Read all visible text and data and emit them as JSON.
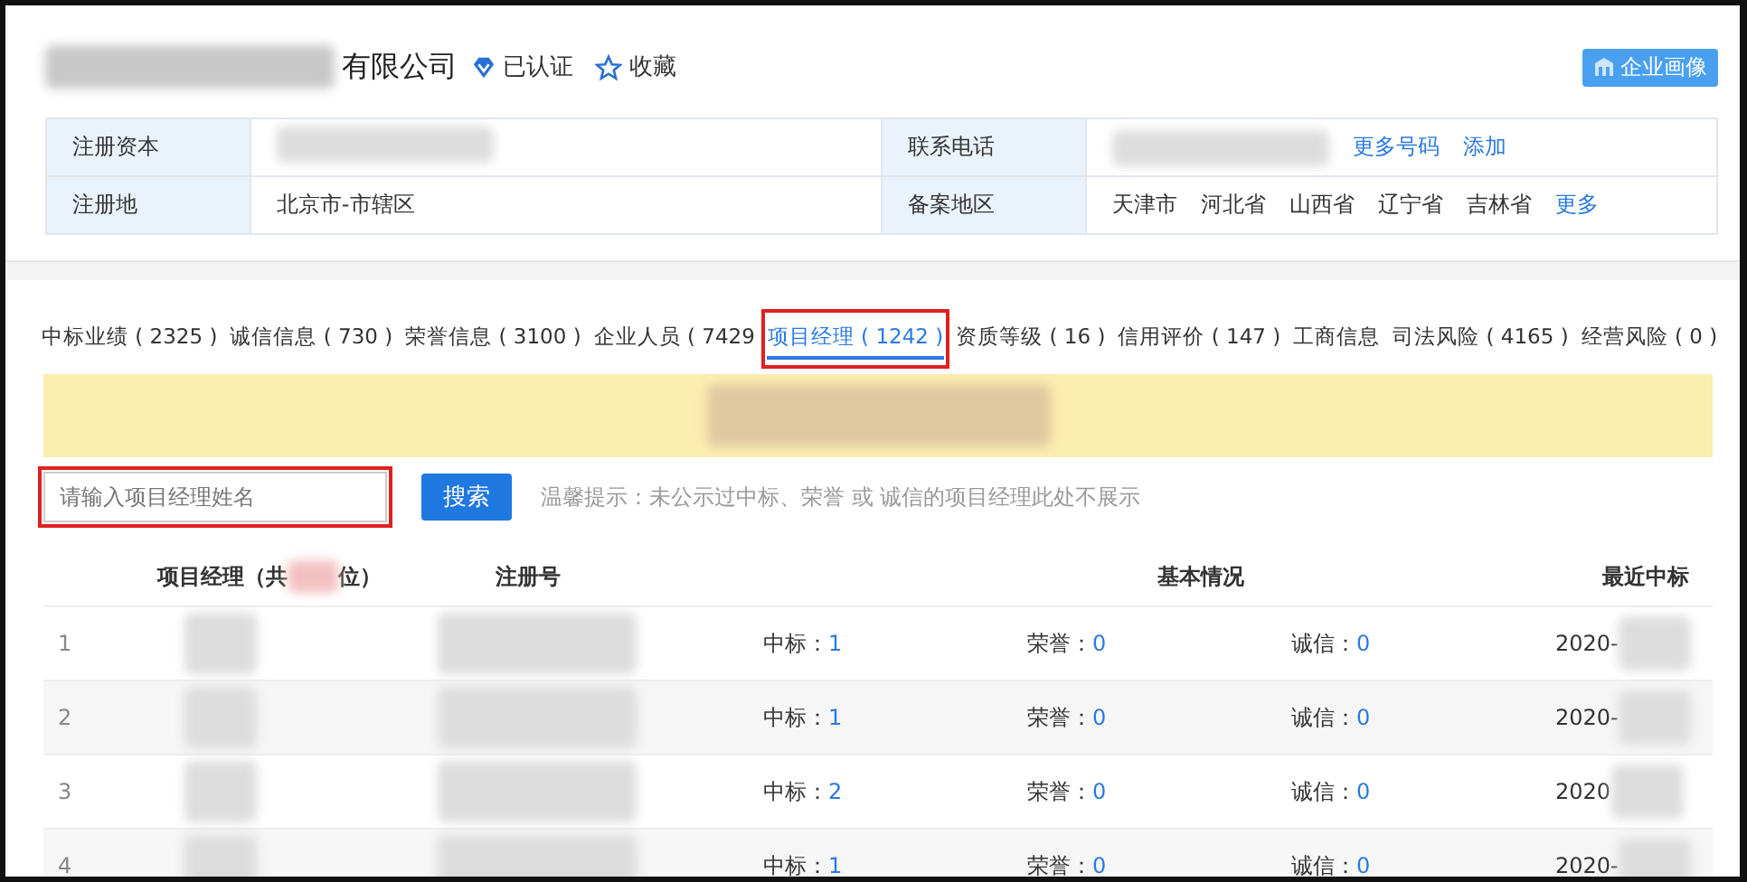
{
  "company": {
    "name": "有限公司",
    "verified": "已认证",
    "favorite": "收藏",
    "portrait_button": "企业画像"
  },
  "info": [
    {
      "label": "注册资本",
      "label_2": "联系电话",
      "links": [
        "更多号码",
        "添加"
      ]
    },
    {
      "label": "注册地",
      "value": "北京市-市辖区",
      "label_2": "备案地区",
      "links": [
        "更多"
      ],
      "regions": [
        "天津市",
        "河北省",
        "山西省",
        "辽宁省",
        "吉林省"
      ]
    }
  ],
  "tabs": [
    {
      "label": "中标业绩 ( 2325 )",
      "selected": false,
      "highlighted": false
    },
    {
      "label": "诚信信息 ( 730 )",
      "selected": false,
      "highlighted": false
    },
    {
      "label": "荣誉信息 ( 3100 )",
      "selected": false,
      "highlighted": false
    },
    {
      "label": "企业人员 ( 7429",
      "selected": false,
      "highlighted": false
    },
    {
      "label": "项目经理 ( 1242 )",
      "selected": true,
      "highlighted": true
    },
    {
      "label": "资质等级 ( 16 )",
      "selected": false,
      "highlighted": false
    },
    {
      "label": "信用评价 ( 147 )",
      "selected": false,
      "highlighted": false
    },
    {
      "label": "工商信息",
      "selected": false,
      "highlighted": false
    },
    {
      "label": "司法风险 ( 4165 )",
      "selected": false,
      "highlighted": false
    },
    {
      "label": "经营风险 ( 0 )",
      "selected": false,
      "highlighted": false
    }
  ],
  "search": {
    "placeholder": "请输入项目经理姓名",
    "highlighted": true,
    "button": "搜索",
    "hint": "温馨提示：未公示过中标、荣誉 或 诚信的项目经理此处不展示"
  },
  "table": {
    "columns": [
      {
        "parts": [
          "项目经理（共",
          "位）"
        ]
      },
      {
        "parts": [
          "注册号"
        ]
      },
      {
        "parts": [
          "基本情况"
        ]
      },
      {
        "parts": [
          "最近中标"
        ]
      }
    ],
    "rows": [
      {
        "index": "1",
        "win_label": "中标：",
        "win": "1",
        "honor_label": "荣誉：",
        "honor": "0",
        "credit_label": "诚信：",
        "credit": "0",
        "date": "2020-"
      },
      {
        "index": "2",
        "win_label": "中标：",
        "win": "1",
        "honor_label": "荣誉：",
        "honor": "0",
        "credit_label": "诚信：",
        "credit": "0",
        "date": "2020-"
      },
      {
        "index": "3",
        "win_label": "中标：",
        "win": "2",
        "honor_label": "荣誉：",
        "honor": "0",
        "credit_label": "诚信：",
        "credit": "0",
        "date": "2020"
      },
      {
        "index": "4",
        "win_label": "中标：",
        "win": "1",
        "honor_label": "荣誉：",
        "honor": "0",
        "credit_label": "诚信：",
        "credit": "0",
        "date": "2020-"
      }
    ]
  }
}
